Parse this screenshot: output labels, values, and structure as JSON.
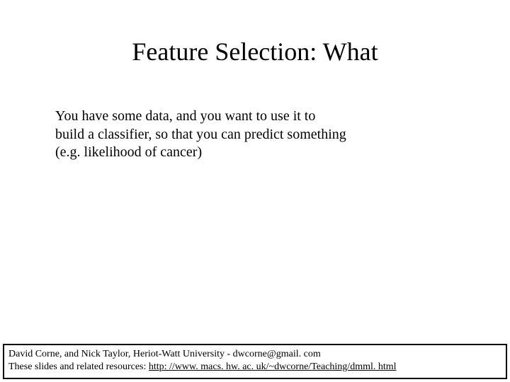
{
  "title": "Feature Selection:  What",
  "body": {
    "line1": "You have some data, and you want to use it to",
    "line2": "build a classifier, so that you can predict something",
    "line3": " (e.g. likelihood of cancer)"
  },
  "footer": {
    "line1": "David Corne, and Nick Taylor,  Heriot-Watt University  -  dwcorne@gmail. com",
    "line2_prefix": "These slides and related resources:   ",
    "link": "http: //www. macs. hw. ac. uk/~dwcorne/Teaching/dmml. html"
  }
}
